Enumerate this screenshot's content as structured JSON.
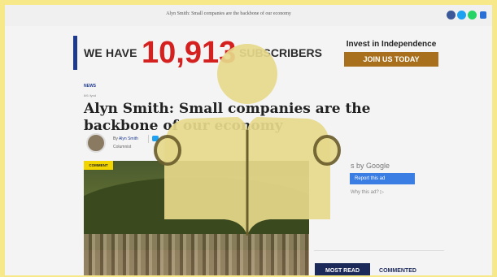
{
  "topbar": {
    "headline": "Alyn Smith: Small companies are the backbone of our economy",
    "share_icons": [
      "facebook-icon",
      "twitter-icon",
      "whatsapp-icon",
      "messenger-icon"
    ]
  },
  "banner": {
    "prefix": "WE HAVE",
    "count": "10,913",
    "suffix": "SUBSCRIBERS"
  },
  "promo": {
    "title": "Invest in Independence",
    "button_label": "JOIN US TODAY"
  },
  "article": {
    "section": "NEWS",
    "date": "8/6 /lynd",
    "title": "Alyn Smith: Small companies are the backbone of our economy",
    "byline_prefix": "By",
    "author": "Alyn Smith",
    "role": "Columnist",
    "tag": "COMMENT"
  },
  "ad": {
    "ads_by": "s by Google",
    "report_label": "Report this ad",
    "why_label": "Why this ad? ▷"
  },
  "tabs": {
    "most_read": "MOST READ",
    "commented": "COMMENTED"
  },
  "colors": {
    "accent_blue": "#1d3a8f",
    "count_red": "#d52020",
    "join_gold": "#a8701d",
    "overlay_icon": "#e6d88a",
    "page_frame": "#f7e98a"
  }
}
